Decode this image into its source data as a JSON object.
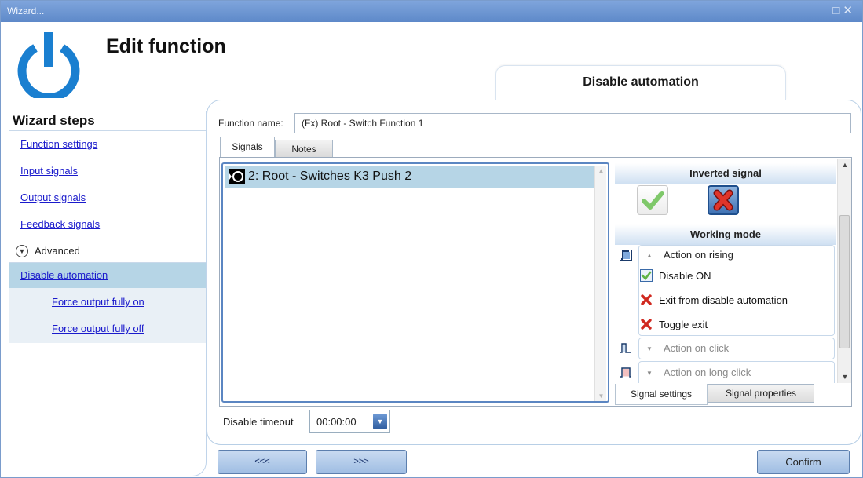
{
  "window": {
    "title": "Wizard...",
    "controls": [
      "□",
      "✕"
    ]
  },
  "header": {
    "title": "Edit function",
    "function_tab": "Disable automation"
  },
  "wizard": {
    "title": "Wizard steps",
    "steps": [
      {
        "label": "Function settings"
      },
      {
        "label": "Input signals"
      },
      {
        "label": "Output signals"
      },
      {
        "label": "Feedback signals"
      }
    ],
    "advanced_label": "Advanced",
    "active_step": "Disable automation",
    "sub_steps": [
      {
        "label": "Force output fully on"
      },
      {
        "label": "Force output fully off"
      }
    ]
  },
  "form": {
    "function_name_label": "Function name:",
    "function_name_value": "(Fx) Root - Switch Function 1",
    "tabs": [
      {
        "label": "Signals",
        "selected": true
      },
      {
        "label": "Notes",
        "selected": false
      }
    ],
    "signals": [
      {
        "label": "2: Root - Switches K3 Push 2",
        "selected": true
      }
    ],
    "properties": {
      "inverted_signal_title": "Inverted signal",
      "inverted_value": "inverted",
      "working_mode_title": "Working mode",
      "action_rising": "Action on rising",
      "options": [
        {
          "label": "Disable ON",
          "checked": true
        },
        {
          "label": "Exit from disable automation",
          "checked": false
        },
        {
          "label": "Toggle exit",
          "checked": false
        }
      ],
      "action_click": "Action on click",
      "action_long_click": "Action on long click",
      "tabs": [
        {
          "label": "Signal settings",
          "selected": true
        },
        {
          "label": "Signal properties",
          "selected": false
        }
      ]
    },
    "timeout_label": "Disable timeout",
    "timeout_value": "00:00:00"
  },
  "footer": {
    "prev_label": "<<<",
    "next_label": ">>>",
    "confirm_label": "Confirm"
  },
  "colors": {
    "titlebar": "#6f96d2",
    "selection": "#b6d5e6",
    "link": "#1a1acc",
    "power_icon": "#1a7fd0",
    "check_green": "#5fb346",
    "cross_red": "#d0281f"
  }
}
